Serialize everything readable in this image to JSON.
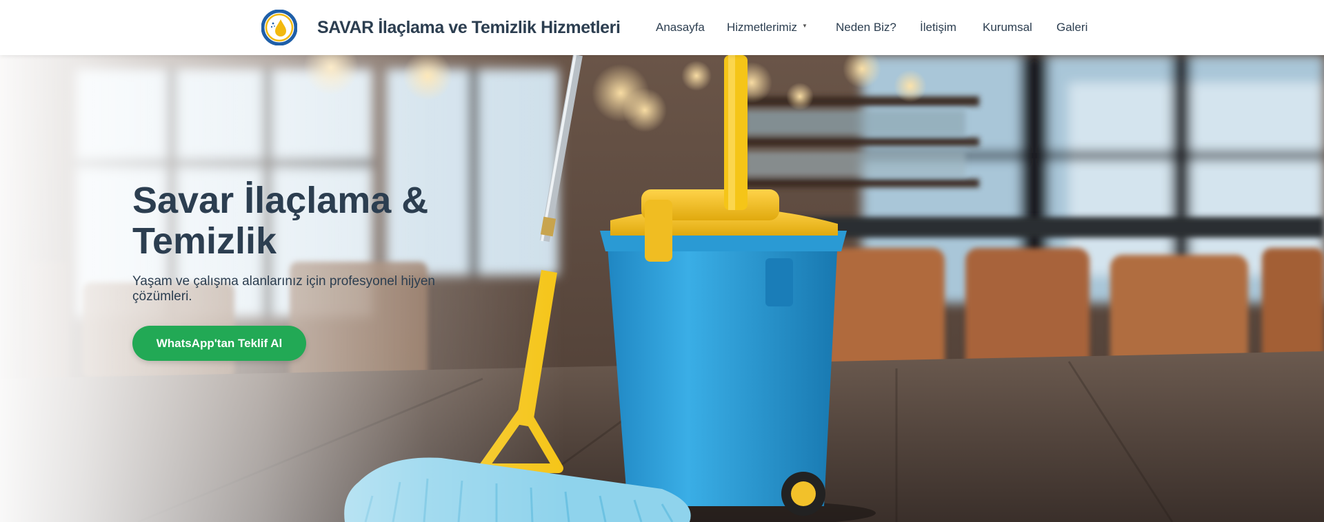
{
  "header": {
    "logo_icon": "water-drop-logo-icon",
    "brand": "SAVAR İlaçlama ve Temizlik Hizmetleri",
    "nav": {
      "home": "Anasayfa",
      "services": "Hizmetlerimiz",
      "why_us": "Neden Biz?",
      "contact": "İletişim",
      "corporate": "Kurumsal",
      "gallery": "Galeri"
    },
    "dropdown_icon": "caret-down-icon"
  },
  "hero": {
    "title_line1": "Savar İlaçlama &",
    "title_line2": "Temizlik",
    "subtitle": "Yaşam ve çalışma alanlarınız için profesyonel hijyen çözümleri.",
    "cta_label": "WhatsApp'tan Teklif Al",
    "background": "mop-and-bucket-photo"
  },
  "colors": {
    "brand_text": "#2c3e50",
    "cta_green": "#22a955",
    "logo_blue": "#1f5fa8",
    "logo_gold": "#f2b90f",
    "bucket_blue": "#2e9fd6",
    "mop_yellow": "#f5c518"
  }
}
